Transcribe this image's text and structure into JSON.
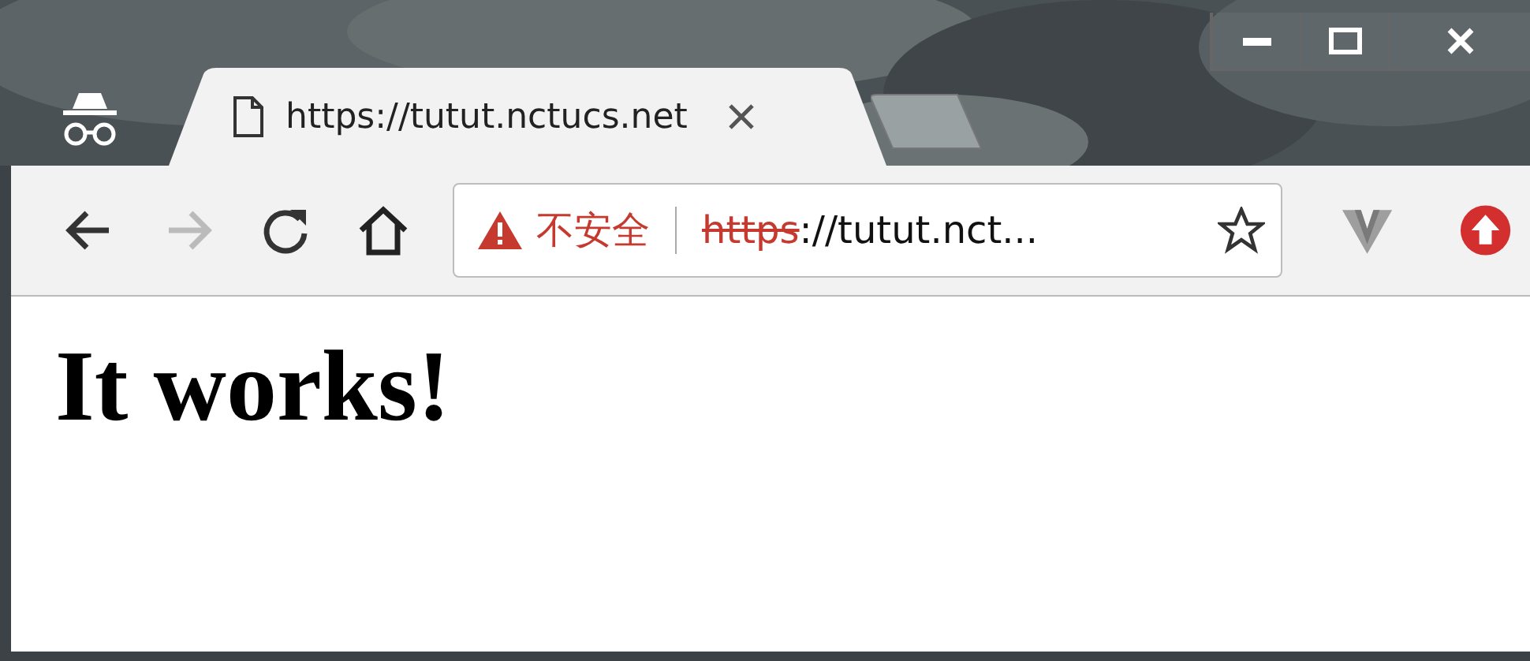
{
  "tabs": [
    {
      "title": "https://tutut.nctucs.net",
      "selected": true
    }
  ],
  "toolbar": {
    "back_disabled": false,
    "forward_disabled": true
  },
  "address_bar": {
    "security_label": "不安全",
    "secure": false,
    "scheme": "https",
    "rest": "://tutut.nct..."
  },
  "page": {
    "heading": "It works!"
  }
}
